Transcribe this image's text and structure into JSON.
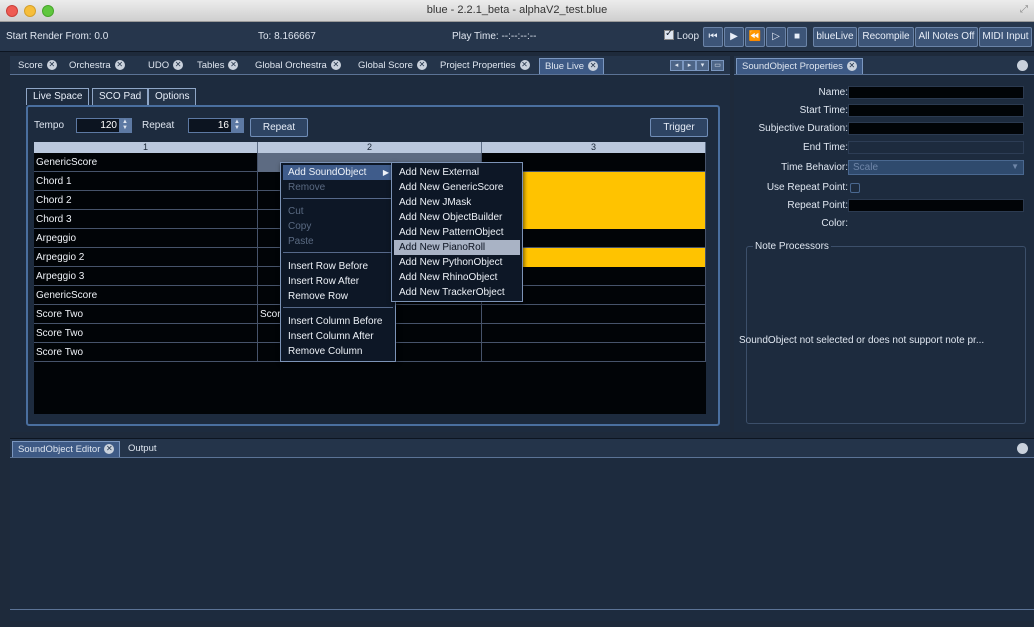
{
  "window": {
    "title": "blue - 2.2.1_beta - alphaV2_test.blue",
    "colors": {
      "close": "#ee5b53",
      "minimize": "#f6be3b",
      "zoom": "#5fc73e"
    }
  },
  "transport": {
    "start_render_label": "Start Render From: 0.0",
    "to_label": "To: 8.166667",
    "play_time_label": "Play Time: --:--:--:--",
    "loop_label": "Loop",
    "loop_checked": true,
    "icons": [
      "rewind-icon",
      "step-back-icon",
      "step-forward-icon",
      "play-icon",
      "stop-icon"
    ],
    "buttons": {
      "bluelive": "blueLive",
      "recompile": "Recompile",
      "all_notes_off": "All Notes Off",
      "midi_input": "MIDI Input"
    }
  },
  "tabs": [
    "Score",
    "Orchestra",
    "UDO",
    "Tables",
    "Global Orchestra",
    "Global Score",
    "Project Properties",
    "Blue Live"
  ],
  "active_tab": "Blue Live",
  "live": {
    "subtabs": [
      "Live Space",
      "SCO Pad",
      "Options"
    ],
    "active_subtab": "Live Space",
    "tempo_label": "Tempo",
    "tempo_value": "120",
    "repeat_label": "Repeat",
    "repeat_value": "16",
    "repeat_button": "Repeat",
    "trigger_button": "Trigger",
    "columns": [
      "1",
      "2",
      "3"
    ],
    "rows": [
      {
        "c1": "GenericScore",
        "c2": "",
        "c3": ""
      },
      {
        "c1": "Chord 1",
        "c2": "",
        "c3": ""
      },
      {
        "c1": "Chord 2",
        "c2": "",
        "c3": ""
      },
      {
        "c1": "Chord 3",
        "c2": "",
        "c3": ""
      },
      {
        "c1": "Arpeggio",
        "c2": "",
        "c3": ""
      },
      {
        "c1": "Arpeggio 2",
        "c2": "",
        "c3": ""
      },
      {
        "c1": "Arpeggio 3",
        "c2": "",
        "c3": ""
      },
      {
        "c1": "GenericScore",
        "c2": "",
        "c3": ""
      },
      {
        "c1": "Score Two",
        "c2": "Score",
        "c3": ""
      },
      {
        "c1": "Score Two",
        "c2": "",
        "c3": ""
      },
      {
        "c1": "Score Two",
        "c2": "",
        "c3": ""
      }
    ],
    "highlight_color": "#ffc300"
  },
  "context_menu": {
    "items": [
      {
        "label": "Add SoundObject",
        "disabled": false,
        "submenu": true
      },
      {
        "label": "Remove",
        "disabled": true
      },
      {
        "label": "Cut",
        "disabled": true
      },
      {
        "label": "Copy",
        "disabled": true
      },
      {
        "label": "Paste",
        "disabled": true
      },
      {
        "label": "Insert Row Before",
        "disabled": false
      },
      {
        "label": "Insert Row After",
        "disabled": false
      },
      {
        "label": "Remove Row",
        "disabled": false
      },
      {
        "label": "Insert Column Before",
        "disabled": false
      },
      {
        "label": "Insert Column After",
        "disabled": false
      },
      {
        "label": "Remove Column",
        "disabled": false
      }
    ],
    "submenu_items": [
      "Add New External",
      "Add New GenericScore",
      "Add New JMask",
      "Add New ObjectBuilder",
      "Add New PatternObject",
      "Add New PianoRoll",
      "Add New PythonObject",
      "Add New RhinoObject",
      "Add New TrackerObject"
    ],
    "selected_submenu_item": "Add New PianoRoll"
  },
  "sound_object_properties": {
    "tab_label": "SoundObject Properties",
    "name_label": "Name:",
    "start_time_label": "Start Time:",
    "subjective_duration_label": "Subjective Duration:",
    "end_time_label": "End Time:",
    "time_behavior_label": "Time Behavior:",
    "time_behavior_value": "Scale",
    "use_repeat_point_label": "Use Repeat Point:",
    "repeat_point_label": "Repeat Point:",
    "color_label": "Color:",
    "note_processors_label": "Note Processors",
    "note_processors_message": "SoundObject not selected or does not support note pr..."
  },
  "bottom": {
    "tabs": [
      "SoundObject Editor",
      "Output"
    ]
  }
}
